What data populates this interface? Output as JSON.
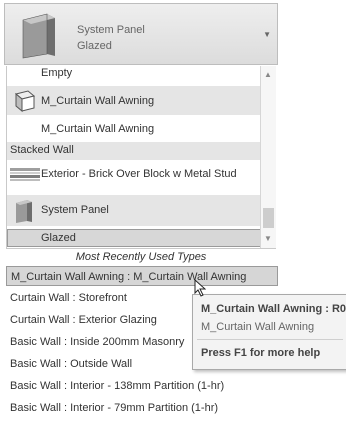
{
  "header": {
    "family": "System Panel",
    "type": "Glazed",
    "thumbnail_icon": "system-panel-thumbnail",
    "dropdown_icon": "chevron-down-icon"
  },
  "type_list": {
    "items": [
      {
        "label": "Empty",
        "kind": "type"
      },
      {
        "label": "M_Curtain Wall Awning",
        "kind": "family",
        "icon": "curtain-awning-icon"
      },
      {
        "label": "M_Curtain Wall Awning",
        "kind": "type"
      },
      {
        "label": "Stacked Wall",
        "kind": "category"
      },
      {
        "label": "Exterior - Brick Over Block w Metal Stud",
        "kind": "family",
        "icon": "stacked-wall-icon"
      },
      {
        "label": "System Panel",
        "kind": "family",
        "icon": "system-panel-icon"
      },
      {
        "label": "Glazed",
        "kind": "type",
        "selected": true
      }
    ]
  },
  "mru": {
    "caption": "Most Recently Used Types",
    "items": [
      "M_Curtain Wall Awning : M_Curtain Wall Awning",
      "Curtain Wall : Storefront",
      "Curtain Wall : Exterior Glazing",
      "Basic Wall : Inside 200mm Masonry",
      "Basic Wall : Outside Wall",
      "Basic Wall : Interior - 138mm Partition (1-hr)",
      "Basic Wall : Interior - 79mm Partition (1-hr)"
    ]
  },
  "tooltip": {
    "title": "M_Curtain Wall Awning : R0",
    "subtitle": "M_Curtain Wall Awning",
    "help": "Press F1 for more help"
  }
}
